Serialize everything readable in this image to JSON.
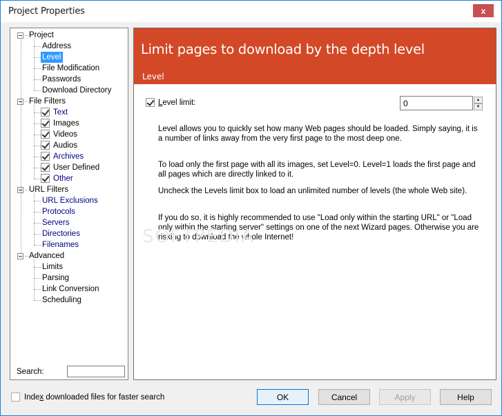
{
  "window": {
    "title": "Project Properties",
    "close_label": "x"
  },
  "tree": {
    "groups": [
      {
        "label": "Project",
        "items": [
          {
            "label": "Address",
            "checkbox": false,
            "style": "normal"
          },
          {
            "label": "Level",
            "checkbox": false,
            "style": "selected"
          },
          {
            "label": "File Modification",
            "checkbox": false,
            "style": "normal"
          },
          {
            "label": "Passwords",
            "checkbox": false,
            "style": "normal"
          },
          {
            "label": "Download Directory",
            "checkbox": false,
            "style": "normal"
          }
        ]
      },
      {
        "label": "File Filters",
        "items": [
          {
            "label": "Text",
            "checkbox": true,
            "checked": true,
            "style": "blue"
          },
          {
            "label": "Images",
            "checkbox": true,
            "checked": true,
            "style": "normal"
          },
          {
            "label": "Videos",
            "checkbox": true,
            "checked": true,
            "style": "normal"
          },
          {
            "label": "Audios",
            "checkbox": true,
            "checked": true,
            "style": "normal"
          },
          {
            "label": "Archives",
            "checkbox": true,
            "checked": true,
            "style": "blue"
          },
          {
            "label": "User Defined",
            "checkbox": true,
            "checked": true,
            "style": "normal"
          },
          {
            "label": "Other",
            "checkbox": true,
            "checked": true,
            "style": "blue"
          }
        ]
      },
      {
        "label": "URL Filters",
        "items": [
          {
            "label": "URL Exclusions",
            "checkbox": false,
            "style": "blue"
          },
          {
            "label": "Protocols",
            "checkbox": false,
            "style": "blue"
          },
          {
            "label": "Servers",
            "checkbox": false,
            "style": "blue"
          },
          {
            "label": "Directories",
            "checkbox": false,
            "style": "blue"
          },
          {
            "label": "Filenames",
            "checkbox": false,
            "style": "blue"
          }
        ]
      },
      {
        "label": "Advanced",
        "items": [
          {
            "label": "Limits",
            "checkbox": false,
            "style": "normal"
          },
          {
            "label": "Parsing",
            "checkbox": false,
            "style": "normal"
          },
          {
            "label": "Link Conversion",
            "checkbox": false,
            "style": "normal"
          },
          {
            "label": "Scheduling",
            "checkbox": false,
            "style": "normal"
          }
        ]
      }
    ],
    "search_label": "Search:",
    "search_value": ""
  },
  "content": {
    "banner_title": "Limit pages to download by the depth level",
    "banner_subtitle": "Level",
    "level_limit_label_underlined": "L",
    "level_limit_label_rest": "evel limit:",
    "level_limit_checked": true,
    "level_value": "0",
    "paragraphs": [
      "Level allows you to quickly set how many Web pages should be loaded. Simply saying, it is a number of links away from the very first page to the most deep one.",
      "To load only the first page with all its images, set Level=0. Level=1 loads the first page and all pages which are directly linked to it.",
      "Uncheck the Levels limit box to load an unlimited number of levels (the whole Web site).",
      "If you do so, it is highly recommended to use \"Load only within the starting URL\" or \"Load only within the starting server\" settings on one of the next Wizard pages. Otherwise you are risking to download the whole Internet!"
    ],
    "watermark": "SOFTPEDIA"
  },
  "footer": {
    "index_label_pre": "Inde",
    "index_label_underlined": "x",
    "index_label_post": " downloaded files for faster search",
    "index_checked": false,
    "buttons": {
      "ok": "OK",
      "cancel": "Cancel",
      "apply": "Apply",
      "help": "Help"
    }
  },
  "colors": {
    "banner": "#d34827",
    "selection": "#3399ff",
    "link_blue": "#000080",
    "close": "#c75050"
  }
}
